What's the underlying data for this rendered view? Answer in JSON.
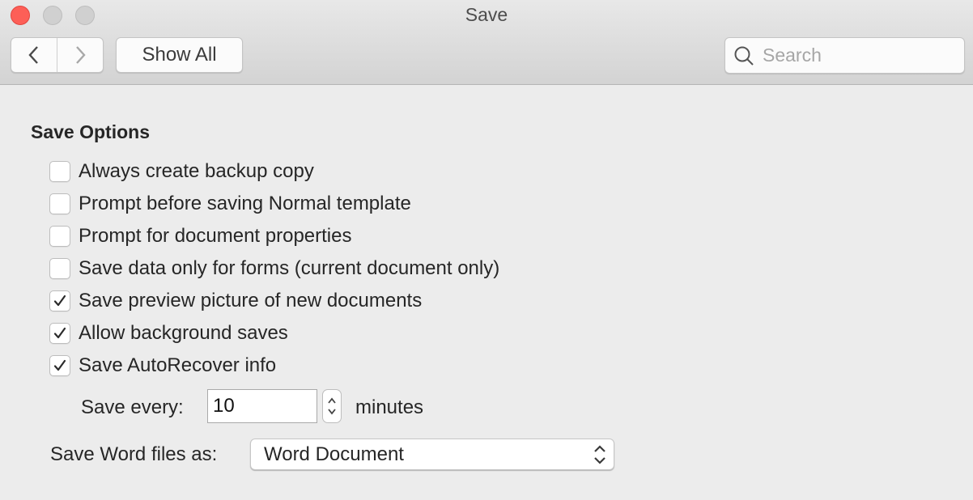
{
  "window": {
    "title": "Save",
    "controls": [
      "close",
      "minimize",
      "zoom"
    ]
  },
  "toolbar": {
    "back_icon": "chevron-left-icon",
    "forward_icon": "chevron-right-icon",
    "show_all_label": "Show All",
    "search_placeholder": "Search",
    "search_icon": "search-icon"
  },
  "section": {
    "title": "Save Options",
    "options": [
      {
        "label": "Always create backup copy",
        "checked": false
      },
      {
        "label": "Prompt before saving Normal template",
        "checked": false
      },
      {
        "label": "Prompt for document properties",
        "checked": false
      },
      {
        "label": "Save data only for forms (current document only)",
        "checked": false
      },
      {
        "label": "Save preview picture of new documents",
        "checked": true
      },
      {
        "label": "Allow background saves",
        "checked": true
      },
      {
        "label": "Save AutoRecover info",
        "checked": true
      }
    ]
  },
  "autosave": {
    "label": "Save every:",
    "value": "10",
    "unit": "minutes"
  },
  "format": {
    "label": "Save Word files as:",
    "selected": "Word Document"
  },
  "colors": {
    "close_button": "#fd5f57",
    "inactive_button": "#d0d0d0",
    "background": "#ececec"
  }
}
